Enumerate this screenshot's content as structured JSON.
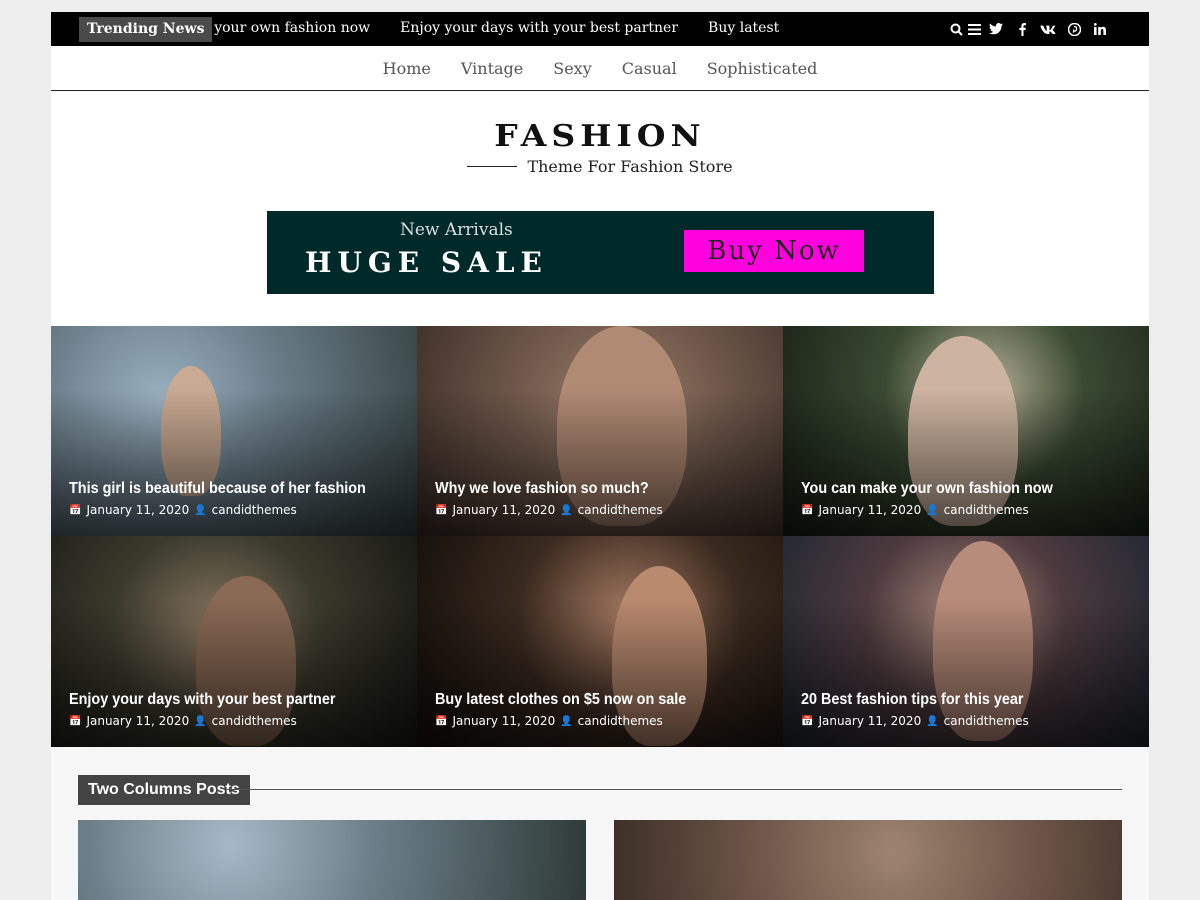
{
  "topbar": {
    "trending_label": "Trending News",
    "ticker": [
      "ke your own fashion now",
      "Enjoy your days with your best partner",
      "Buy latest"
    ],
    "icons": [
      "search-icon",
      "menu-icon",
      "twitter-icon",
      "facebook-icon",
      "vk-icon",
      "pinterest-icon",
      "linkedin-icon"
    ]
  },
  "nav": {
    "items": [
      "Home",
      "Vintage",
      "Sexy",
      "Casual",
      "Sophisticated"
    ]
  },
  "logo": {
    "title": "FASHION",
    "subtitle": "Theme For Fashion Store"
  },
  "banner": {
    "kicker": "New Arrivals",
    "headline": "HUGE SALE",
    "cta": "Buy Now",
    "bg_color": "#002a2a",
    "cta_color": "#ff00de"
  },
  "posts": [
    {
      "title": "This girl is beautiful because of her fashion",
      "date": "January 11, 2020",
      "author": "candidthemes"
    },
    {
      "title": "Why we love fashion so much?",
      "date": "January 11, 2020",
      "author": "candidthemes"
    },
    {
      "title": "You can make your own fashion now",
      "date": "January 11, 2020",
      "author": "candidthemes"
    },
    {
      "title": "Enjoy your days with your best partner",
      "date": "January 11, 2020",
      "author": "candidthemes"
    },
    {
      "title": "Buy latest clothes on $5 now on sale",
      "date": "January 11, 2020",
      "author": "candidthemes"
    },
    {
      "title": "20 Best fashion tips for this year",
      "date": "January 11, 2020",
      "author": "candidthemes"
    }
  ],
  "section": {
    "title": "Two Columns Posts"
  },
  "icons": {
    "calendar": "📅",
    "user": "👤"
  }
}
